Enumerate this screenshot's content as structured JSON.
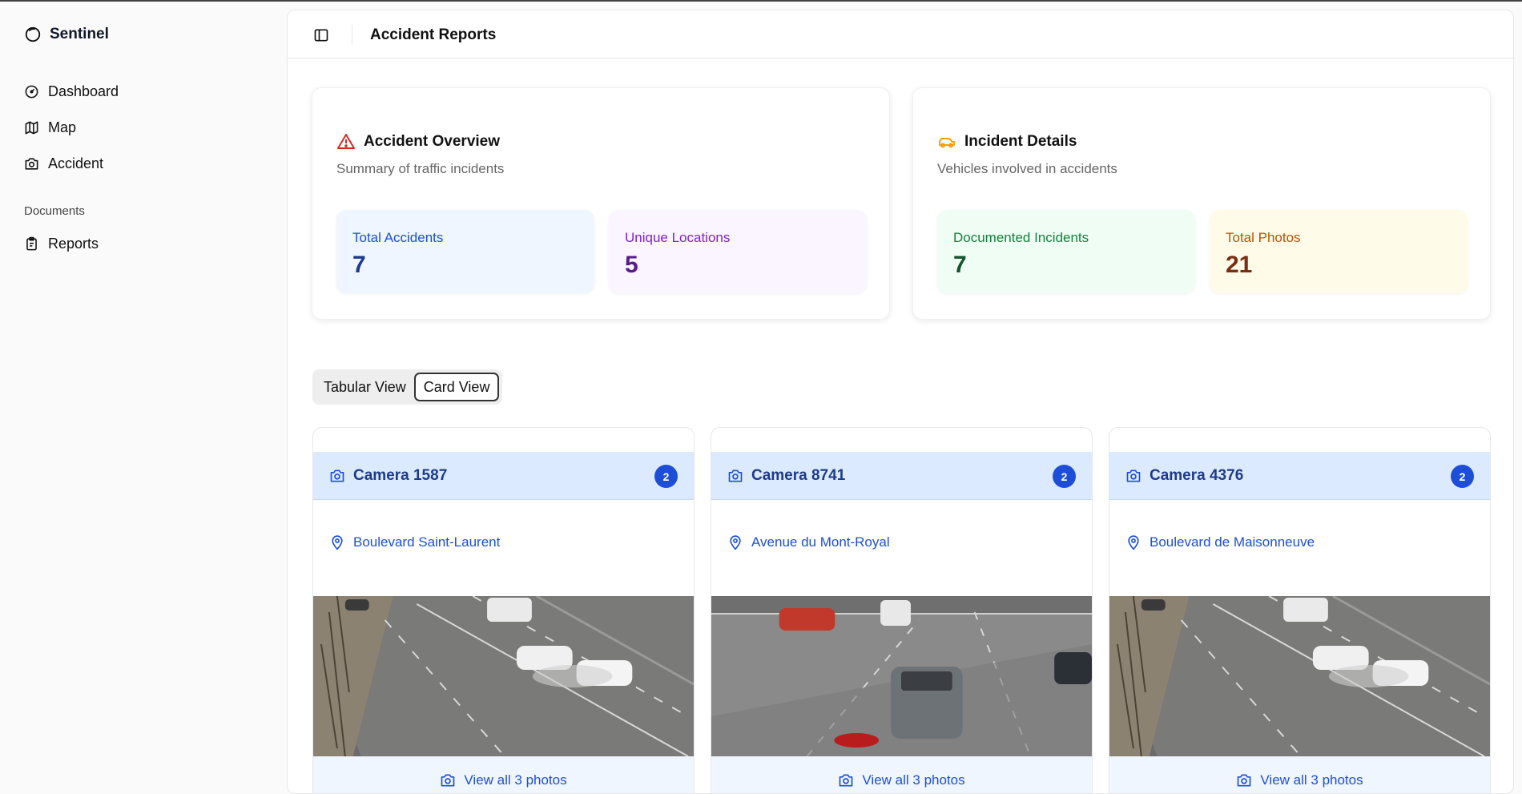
{
  "app": {
    "name": "Sentinel"
  },
  "sidebar": {
    "items": [
      {
        "label": "Dashboard",
        "icon": "gauge-icon"
      },
      {
        "label": "Map",
        "icon": "map-icon"
      },
      {
        "label": "Accident",
        "icon": "camera-icon"
      }
    ],
    "documents_label": "Documents",
    "documents_items": [
      {
        "label": "Reports",
        "icon": "clipboard-icon"
      }
    ]
  },
  "header": {
    "title": "Accident Reports"
  },
  "overview": {
    "title": "Accident Overview",
    "subtitle": "Summary of traffic incidents",
    "tiles": [
      {
        "label": "Total Accidents",
        "value": "7"
      },
      {
        "label": "Unique Locations",
        "value": "5"
      }
    ]
  },
  "incidents": {
    "title": "Incident Details",
    "subtitle": "Vehicles involved in accidents",
    "tiles": [
      {
        "label": "Documented Incidents",
        "value": "7"
      },
      {
        "label": "Total Photos",
        "value": "21"
      }
    ]
  },
  "view_toggle": {
    "tabular": "Tabular View",
    "card": "Card View",
    "selected": "Card View"
  },
  "cameras": [
    {
      "title": "Camera 1587",
      "badge": "2",
      "location": "Boulevard Saint-Laurent",
      "view_all": "View all 3 photos"
    },
    {
      "title": "Camera 8741",
      "badge": "2",
      "location": "Avenue du Mont-Royal",
      "view_all": "View all 3 photos"
    },
    {
      "title": "Camera 4376",
      "badge": "2",
      "location": "Boulevard de Maisonneuve",
      "view_all": "View all 3 photos"
    }
  ],
  "colors": {
    "accent_blue": "#1d4ed8",
    "warning_red": "#dc2626",
    "car_orange": "#f59e0b",
    "tile_blue_bg": "#eff6ff",
    "tile_purple_bg": "#faf5ff",
    "tile_green_bg": "#f0fdf4",
    "tile_yellow_bg": "#fefce8"
  }
}
